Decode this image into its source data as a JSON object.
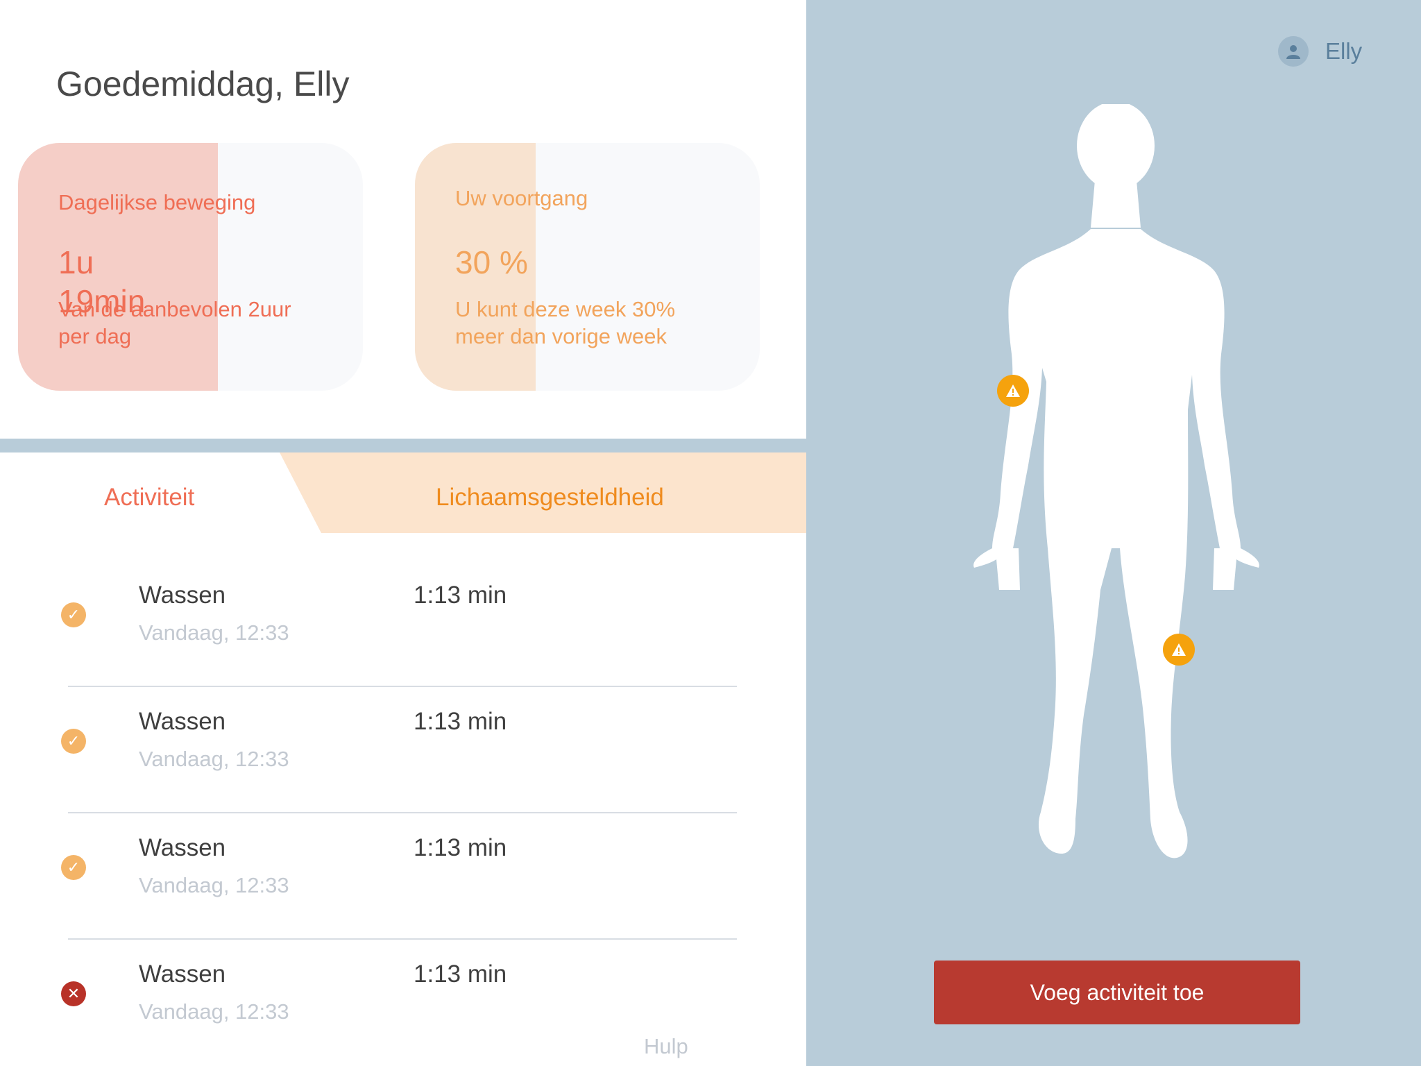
{
  "greeting": "Goedemiddag, Elly",
  "cards": {
    "movement": {
      "title": "Dagelijkse beweging",
      "value": "1u 19min",
      "description": "Van de aanbevolen 2uur per dag",
      "fill_fraction": 0.58,
      "color": "#ef6e55"
    },
    "progress": {
      "title": "Uw voortgang",
      "value": "30 %",
      "description": "U kunt deze week 30% meer dan vorige week",
      "fill_fraction": 0.35,
      "color": "#f2a45c"
    }
  },
  "tabs": [
    {
      "label": "Activiteit",
      "active": true
    },
    {
      "label": "Lichaamsgesteldheid",
      "active": false
    }
  ],
  "activities": [
    {
      "name": "Wassen",
      "time": "Vandaag, 12:33",
      "duration": "1:13 min",
      "status": "done",
      "status_icon": "check-icon"
    },
    {
      "name": "Wassen",
      "time": "Vandaag, 12:33",
      "duration": "1:13 min",
      "status": "done",
      "status_icon": "check-icon"
    },
    {
      "name": "Wassen",
      "time": "Vandaag, 12:33",
      "duration": "1:13 min",
      "status": "done",
      "status_icon": "check-icon"
    },
    {
      "name": "Wassen",
      "time": "Vandaag, 12:33",
      "duration": "1:13 min",
      "status": "failed",
      "status_icon": "close-icon"
    }
  ],
  "help_label": "Hulp",
  "user": {
    "name": "Elly",
    "icon": "user-icon"
  },
  "body_markers": [
    {
      "location": "left-elbow",
      "icon": "warning-icon"
    },
    {
      "location": "left-knee",
      "icon": "warning-icon"
    }
  ],
  "add_button_label": "Voeg activiteit toe",
  "colors": {
    "accent_red": "#b83a30",
    "accent_orange": "#f5a20d",
    "panel_blue": "#b8ccd9"
  }
}
